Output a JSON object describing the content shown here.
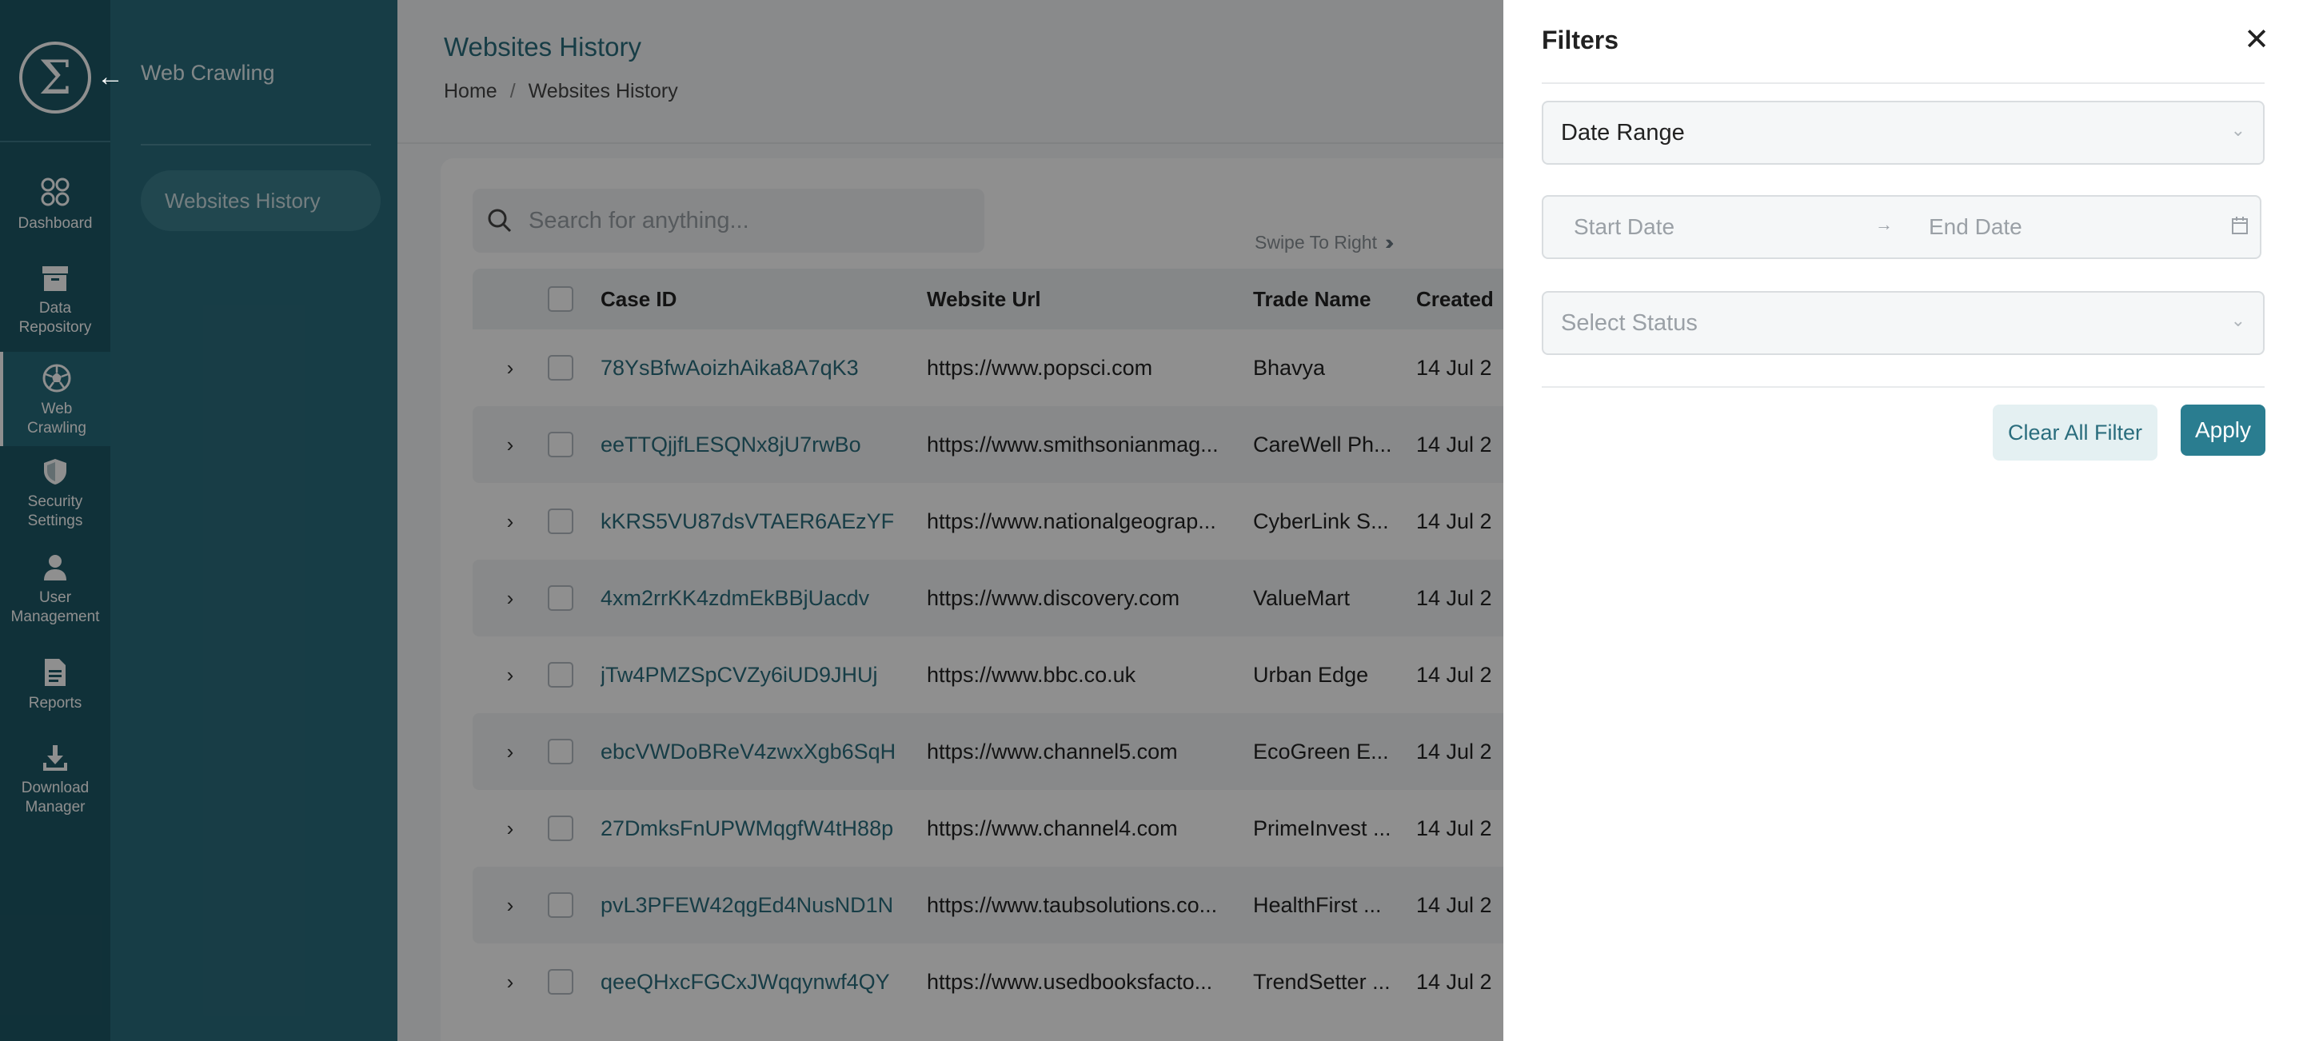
{
  "rail": {
    "items": [
      {
        "label": "Dashboard",
        "icon": "dashboard-icon"
      },
      {
        "label": "Data\nRepository",
        "icon": "archive-icon"
      },
      {
        "label": "Web\nCrawling",
        "icon": "soccer-ball-icon",
        "active": true
      },
      {
        "label": "Security\nSettings",
        "icon": "shield-icon"
      },
      {
        "label": "User\nManagement",
        "icon": "user-icon"
      },
      {
        "label": "Reports",
        "icon": "document-icon"
      },
      {
        "label": "Download\nManager",
        "icon": "download-icon"
      }
    ]
  },
  "subnav": {
    "title": "Web Crawling",
    "item": "Websites History"
  },
  "page": {
    "title": "Websites History",
    "breadcrumb": {
      "home": "Home",
      "sep": "/",
      "current": "Websites History"
    }
  },
  "search": {
    "placeholder": "Search for anything..."
  },
  "swipe": {
    "label": "Swipe To Right",
    "chevrons": "›››››"
  },
  "table": {
    "columns": {
      "case_id": "Case ID",
      "url": "Website Url",
      "trade": "Trade Name",
      "created": "Created"
    },
    "rows": [
      {
        "case_id": "78YsBfwAoizhAika8A7qK3",
        "url": "https://www.popsci.com",
        "trade": "Bhavya",
        "created": "14 Jul 2"
      },
      {
        "case_id": "eeTTQjjfLESQNx8jU7rwBo",
        "url": "https://www.smithsonianmag...",
        "trade": "CareWell Ph...",
        "created": "14 Jul 2"
      },
      {
        "case_id": "kKRS5VU87dsVTAER6AEzYF",
        "url": "https://www.nationalgeograp...",
        "trade": "CyberLink S...",
        "created": "14 Jul 2"
      },
      {
        "case_id": "4xm2rrKK4zdmEkBBjUacdv",
        "url": "https://www.discovery.com",
        "trade": "ValueMart",
        "created": "14 Jul 2"
      },
      {
        "case_id": "jTw4PMZSpCVZy6iUD9JHUj",
        "url": "https://www.bbc.co.uk",
        "trade": "Urban Edge",
        "created": "14 Jul 2"
      },
      {
        "case_id": "ebcVWDoBReV4zwxXgb6SqH",
        "url": "https://www.channel5.com",
        "trade": "EcoGreen E...",
        "created": "14 Jul 2"
      },
      {
        "case_id": "27DmksFnUPWMqgfW4tH88p",
        "url": "https://www.channel4.com",
        "trade": "PrimeInvest ...",
        "created": "14 Jul 2"
      },
      {
        "case_id": "pvL3PFEW42qgEd4NusND1N",
        "url": "https://www.taubsolutions.co...",
        "trade": "HealthFirst ...",
        "created": "14 Jul 2"
      },
      {
        "case_id": "qeeQHxcFGCxJWqqynwf4QY",
        "url": "https://www.usedbooksfacto...",
        "trade": "TrendSetter ...",
        "created": "14 Jul 2"
      }
    ]
  },
  "filters": {
    "title": "Filters",
    "date_range_label": "Date Range",
    "start_placeholder": "Start Date",
    "arrow": "→",
    "end_placeholder": "End Date",
    "status_placeholder": "Select Status",
    "clear_label": "Clear All Filter",
    "apply_label": "Apply"
  },
  "colors": {
    "brand": "#2a6d7d",
    "rail": "#1e5866",
    "accent_button": "#2a7d90"
  }
}
